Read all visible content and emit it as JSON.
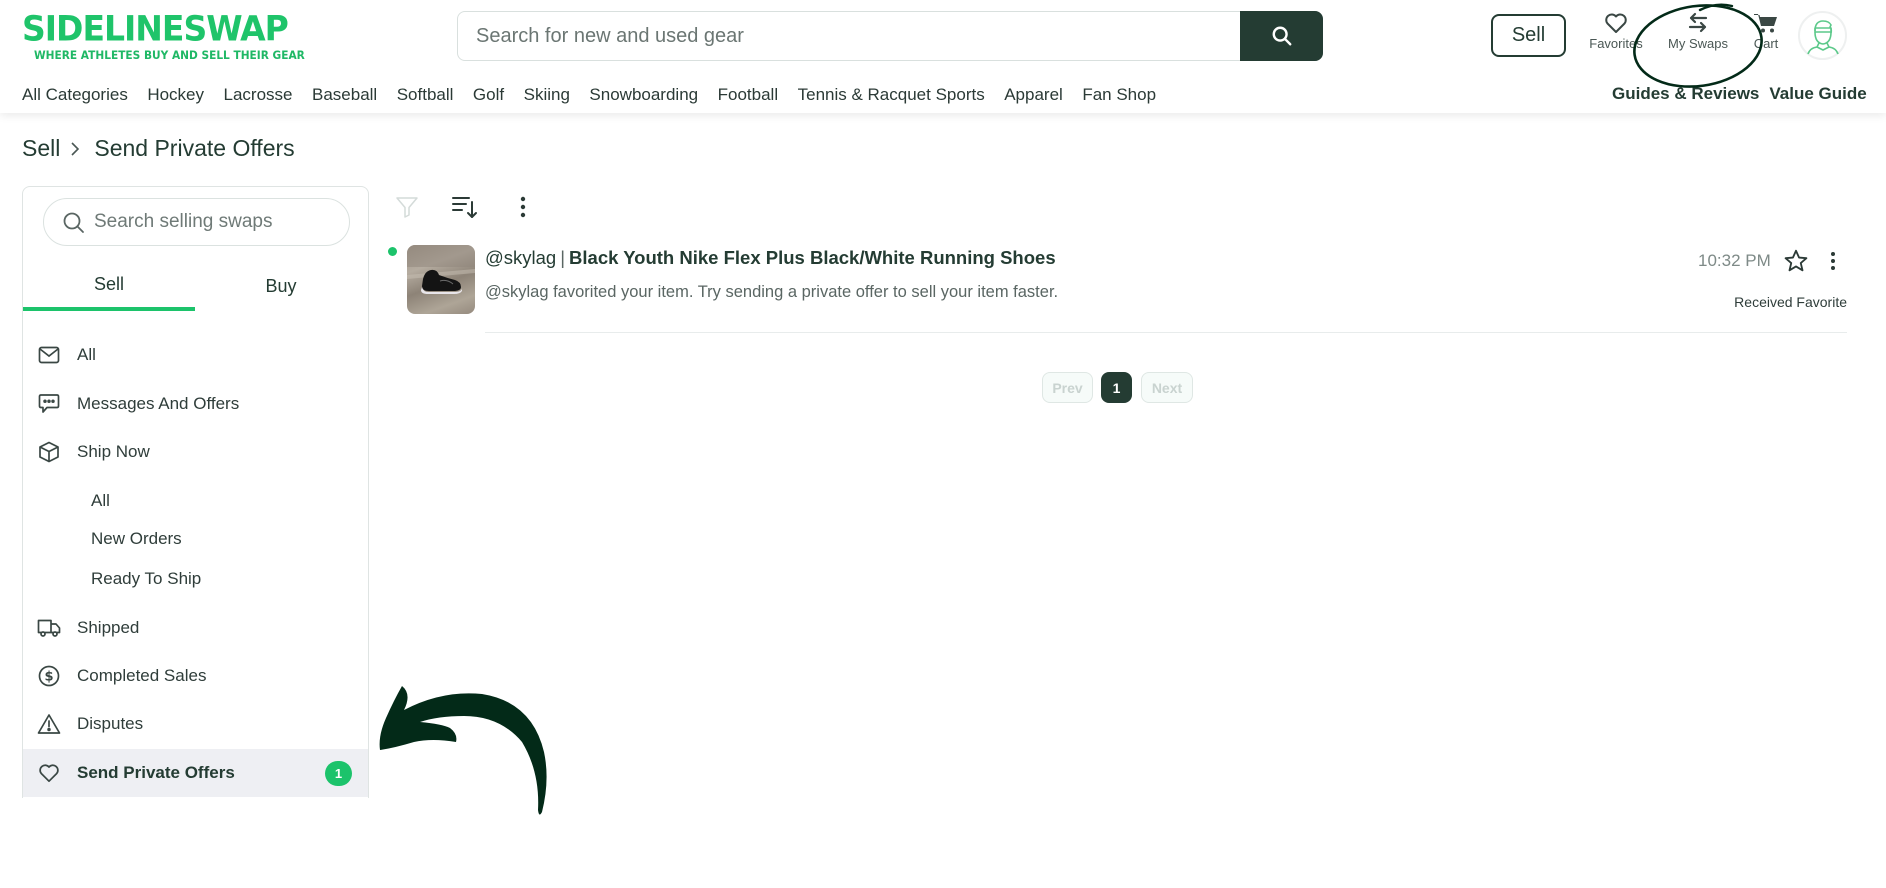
{
  "brand": {
    "name": "SidelineSwap",
    "wordmark": "SIDELINESWAP",
    "tagline": "WHERE ATHLETES BUY AND SELL THEIR GEAR",
    "accent_color": "#1fc46a",
    "dark_color": "#243c33"
  },
  "header": {
    "search": {
      "placeholder": "Search for new and used gear",
      "value": ""
    },
    "sell_label": "Sell",
    "icons": [
      {
        "name": "favorites",
        "icon": "heart-icon",
        "label": "Favorites"
      },
      {
        "name": "my-swaps",
        "icon": "swap-arrows-icon",
        "label": "My Swaps"
      },
      {
        "name": "cart",
        "icon": "cart-icon",
        "label": "Cart"
      }
    ],
    "avatar_icon": "athlete-avatar-icon"
  },
  "category_nav": [
    "All Categories",
    "Hockey",
    "Lacrosse",
    "Baseball",
    "Softball",
    "Golf",
    "Skiing",
    "Snowboarding",
    "Football",
    "Tennis & Racquet Sports",
    "Apparel",
    "Fan Shop"
  ],
  "right_nav": [
    "Guides & Reviews",
    "Value Guide"
  ],
  "breadcrumb": {
    "parent": "Sell",
    "current": "Send Private Offers"
  },
  "sidebar": {
    "search_placeholder": "Search selling swaps",
    "tabs": [
      {
        "label": "Sell",
        "active": true
      },
      {
        "label": "Buy",
        "active": false
      }
    ],
    "items": [
      {
        "label": "All",
        "icon": "envelope-icon"
      },
      {
        "label": "Messages And Offers",
        "icon": "chat-bubble-icon"
      },
      {
        "label": "Ship Now",
        "icon": "box-icon"
      },
      {
        "label": "All",
        "sub": true
      },
      {
        "label": "New Orders",
        "sub": true
      },
      {
        "label": "Ready To Ship",
        "sub": true
      },
      {
        "label": "Shipped",
        "icon": "truck-icon"
      },
      {
        "label": "Completed Sales",
        "icon": "dollar-circle-icon"
      },
      {
        "label": "Disputes",
        "icon": "warning-triangle-icon"
      },
      {
        "label": "Send Private Offers",
        "icon": "heart-icon",
        "active": true,
        "badge": "1"
      }
    ]
  },
  "toolbar": {
    "filter_icon": "filter-icon",
    "sort_icon": "sort-icon",
    "more_icon": "kebab-icon"
  },
  "list": [
    {
      "username": "@skylag",
      "separator": "|",
      "title": "Black Youth Nike Flex Plus Black/White Running Shoes",
      "subtitle": "@skylag favorited your item. Try sending a private offer to sell your item faster.",
      "time": "10:32 PM",
      "status": "Received Favorite",
      "unread": true
    }
  ],
  "pagination": {
    "prev": "Prev",
    "current": "1",
    "next": "Next"
  },
  "annotations": {
    "circle_target": "My Swaps",
    "arrow_target": "Send Private Offers",
    "color": "#032a18"
  }
}
